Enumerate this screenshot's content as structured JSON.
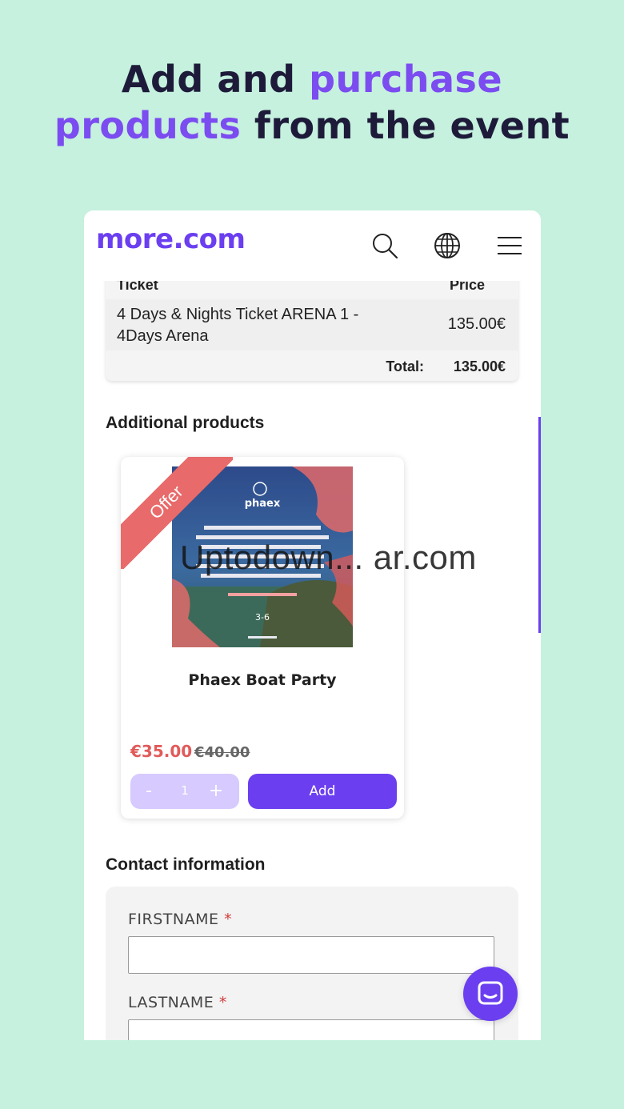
{
  "headline": {
    "line1_plain": "Add and ",
    "line1_accent": "purchase",
    "line2_accent": "products",
    "line2_plain": " from the event"
  },
  "header": {
    "logo": "more.com",
    "icons": [
      "search-icon",
      "globe-icon",
      "menu-icon"
    ]
  },
  "ticket": {
    "col_ticket": "Ticket",
    "col_price": "Price",
    "item_name": "4 Days & Nights Ticket ARENA 1 - 4Days Arena",
    "item_price": "135.00€",
    "total_label": "Total:",
    "total_value": "135.00€"
  },
  "additional": {
    "title": "Additional products",
    "product": {
      "badge": "Offer",
      "name": "Phaex Boat Party",
      "price": "€35.00",
      "old_price": "€40.00",
      "quantity": "1",
      "minus": "-",
      "plus": "+",
      "add_label": "Add"
    }
  },
  "watermark": "Uptodown... ar.com",
  "contact": {
    "title": "Contact information",
    "firstname_label": "FIRSTNAME",
    "lastname_label": "LASTNAME",
    "required_mark": "*"
  },
  "colors": {
    "background": "#c5f1de",
    "brand": "#6b3ff0",
    "accent_text": "#7b4cf0",
    "offer": "#e86a6a",
    "sale_price": "#e25a5a"
  }
}
